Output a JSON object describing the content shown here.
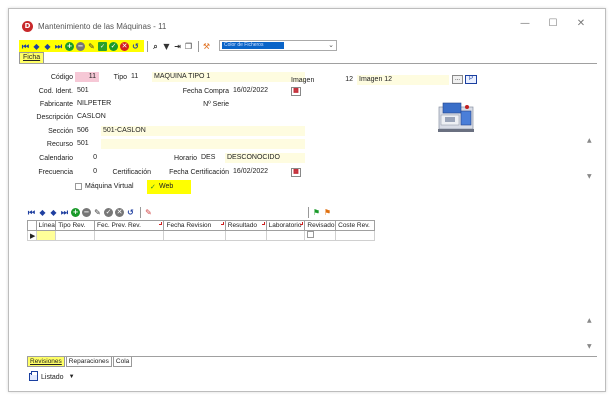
{
  "window": {
    "app_icon": "D",
    "title": "Mantenimiento de las Máquinas -  11",
    "controls": [
      "—",
      "☐",
      "✕"
    ]
  },
  "toolbar": {
    "combo_value": "Color de Ficheros"
  },
  "tabs": {
    "ficha": "Ficha"
  },
  "form": {
    "codigo_label": "Código",
    "codigo_value": "11",
    "tipo_label": "Tipo",
    "tipo_value": "11",
    "tipo_desc": "MAQUINA TIPO 1",
    "codident_label": "Cod. Ident.",
    "codident_value": "501",
    "fechacompra_label": "Fecha Compra",
    "fechacompra_value": "16/02/2022",
    "fabricante_label": "Fabricante",
    "fabricante_value": "NILPETER",
    "nserie_label": "Nº Serie",
    "nserie_value": "",
    "descripcion_label": "Descripción",
    "descripcion_value": "CASLON",
    "seccion_label": "Sección",
    "seccion_value": "506",
    "seccion_desc": "501-CASLON",
    "recurso_label": "Recurso",
    "recurso_value": "501",
    "calendario_label": "Calendario",
    "calendario_value": "0",
    "horario_label": "Horario",
    "horario_value": "DES",
    "horario_desc": "DESCONOCIDO",
    "frecuencia_label": "Frecuencia",
    "frecuencia_value": "0",
    "certificacion_label": "Certificación",
    "fechacert_label": "Fecha Certificación",
    "fechacert_value": "16/02/2022",
    "imagen_label": "Imagen",
    "imagen_value": "12",
    "imagen_desc": "Imagen 12",
    "imagen_btn": "...",
    "imagen_btn2": "P",
    "maquina_virtual_label": "Máquina Virtual",
    "web_label": "Web",
    "web_checked": true
  },
  "grid": {
    "columns": [
      "Línea",
      "Tipo Rev.",
      "Fec. Prev. Rev.",
      "Fecha Revision",
      "Resultado",
      "Laboratorio",
      "Revisado",
      "Coste Rev."
    ]
  },
  "bottom_tabs": [
    "Revisiones",
    "Reparaciones",
    "Cola"
  ],
  "listado": {
    "label": "Listado"
  }
}
